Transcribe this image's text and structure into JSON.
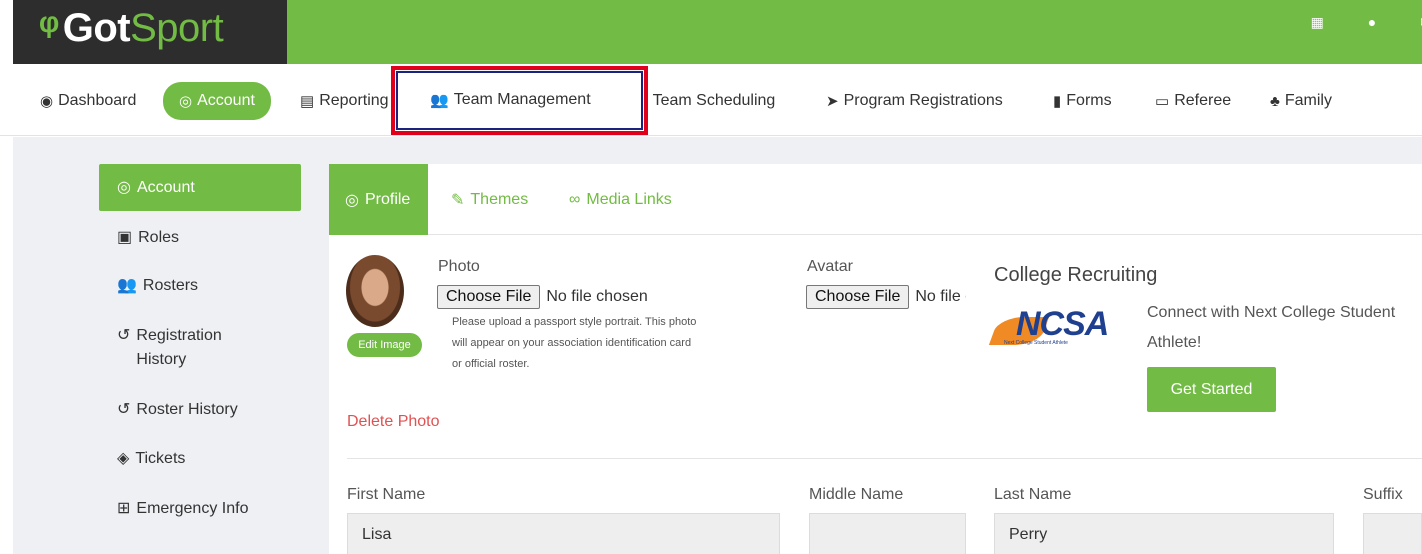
{
  "header": {
    "logo_text": "GotSport",
    "logo_prefix": "Got",
    "logo_suffix": "Sport",
    "icons": [
      "qr-code-icon",
      "user-icon",
      "envelope-icon"
    ]
  },
  "nav": {
    "items": [
      {
        "label": "Dashboard",
        "icon": "dashboard-icon"
      },
      {
        "label": "Account",
        "icon": "user-circle-icon",
        "active": true
      },
      {
        "label": "Reporting",
        "icon": "file-icon"
      },
      {
        "label": "Team Management",
        "icon": "users-icon",
        "highlighted": true
      },
      {
        "label": "Team Scheduling",
        "icon": "arrows-icon"
      },
      {
        "label": "Program Registrations",
        "icon": "paper-plane-icon"
      },
      {
        "label": "Forms",
        "icon": "file-solid-icon"
      },
      {
        "label": "Referee",
        "icon": "calendar-icon"
      },
      {
        "label": "Family",
        "icon": "sitemap-icon"
      }
    ]
  },
  "sidebar": {
    "items": [
      {
        "label": "Account",
        "active": true
      },
      {
        "label": "Roles"
      },
      {
        "label": "Rosters"
      },
      {
        "label": "Registration History"
      },
      {
        "label": "Roster History"
      },
      {
        "label": "Tickets"
      },
      {
        "label": "Emergency Info"
      }
    ]
  },
  "tabs": {
    "items": [
      {
        "label": "Profile",
        "active": true
      },
      {
        "label": "Themes"
      },
      {
        "label": "Media Links"
      }
    ]
  },
  "profile": {
    "photo_label": "Photo",
    "choose_file": "Choose File",
    "no_file": "No file chosen",
    "avatar_label": "Avatar",
    "avatar_no_file": "No file chosen",
    "hint": "Please upload a passport style portrait. This photo will appear on your association identification card or official roster.",
    "edit_image": "Edit Image",
    "delete_photo": "Delete Photo"
  },
  "college": {
    "title": "College Recruiting",
    "logo_text": "NCSA",
    "logo_tagline": "Next College Student Athlete",
    "text": "Connect with Next College Student Athlete!",
    "text_line1": "Connect with Next College Student",
    "text_line2": "Athlete!",
    "button": "Get Started"
  },
  "fields": {
    "first_name_label": "First Name",
    "first_name_value": "Lisa",
    "middle_name_label": "Middle Name",
    "middle_name_value": "",
    "last_name_label": "Last Name",
    "last_name_value": "Perry",
    "suffix_label": "Suffix",
    "suffix_value": ""
  },
  "colors": {
    "brand_green": "#72bb44",
    "logo_dark": "#2d2d2d",
    "highlight_red": "#e0001b",
    "delete_red": "#e05252"
  }
}
